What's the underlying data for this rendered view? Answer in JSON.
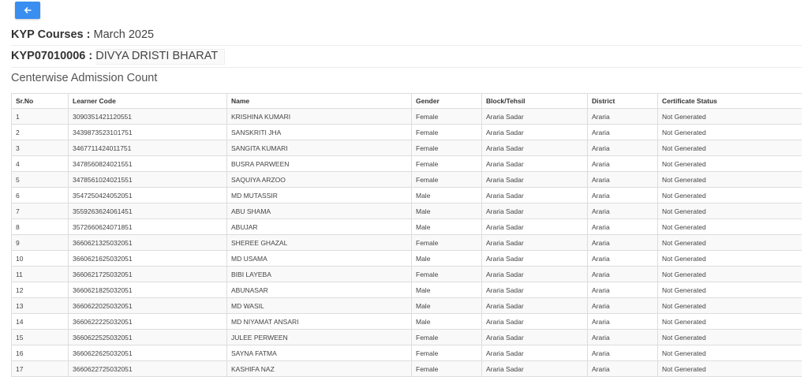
{
  "back_button": {
    "icon": "arrow-left-icon"
  },
  "course": {
    "label": "KYP Courses :",
    "value": "March 2025"
  },
  "center": {
    "code": "KYP07010006 :",
    "name": "DIVYA DRISTI BHARAT"
  },
  "section_title": "Centerwise Admission Count",
  "table": {
    "headers": [
      "Sr.No",
      "Learner Code",
      "Name",
      "Gender",
      "Block/Tehsil",
      "District",
      "Certificate Status"
    ],
    "rows": [
      [
        "1",
        "3090351421120551",
        "KRISHINA KUMARI",
        "Female",
        "Araria Sadar",
        "Araria",
        "Not Generated"
      ],
      [
        "2",
        "3439873523101751",
        "SANSKRITI JHA",
        "Female",
        "Araria Sadar",
        "Araria",
        "Not Generated"
      ],
      [
        "3",
        "3467711424011751",
        "SANGITA KUMARI",
        "Female",
        "Araria Sadar",
        "Araria",
        "Not Generated"
      ],
      [
        "4",
        "3478560824021551",
        "BUSRA PARWEEN",
        "Female",
        "Araria Sadar",
        "Araria",
        "Not Generated"
      ],
      [
        "5",
        "3478561024021551",
        "SAQUIYA ARZOO",
        "Female",
        "Araria Sadar",
        "Araria",
        "Not Generated"
      ],
      [
        "6",
        "3547250424052051",
        "MD MUTASSIR",
        "Male",
        "Araria Sadar",
        "Araria",
        "Not Generated"
      ],
      [
        "7",
        "3559263624061451",
        "ABU SHAMA",
        "Male",
        "Araria Sadar",
        "Araria",
        "Not Generated"
      ],
      [
        "8",
        "3572660624071851",
        "ABUJAR",
        "Male",
        "Araria Sadar",
        "Araria",
        "Not Generated"
      ],
      [
        "9",
        "3660621325032051",
        "SHEREE GHAZAL",
        "Female",
        "Araria Sadar",
        "Araria",
        "Not Generated"
      ],
      [
        "10",
        "3660621625032051",
        "MD USAMA",
        "Male",
        "Araria Sadar",
        "Araria",
        "Not Generated"
      ],
      [
        "11",
        "3660621725032051",
        "BIBI LAYEBA",
        "Female",
        "Araria Sadar",
        "Araria",
        "Not Generated"
      ],
      [
        "12",
        "3660621825032051",
        "ABUNASAR",
        "Male",
        "Araria Sadar",
        "Araria",
        "Not Generated"
      ],
      [
        "13",
        "3660622025032051",
        "MD WASIL",
        "Male",
        "Araria Sadar",
        "Araria",
        "Not Generated"
      ],
      [
        "14",
        "3660622225032051",
        "MD NIYAMAT ANSARI",
        "Male",
        "Araria Sadar",
        "Araria",
        "Not Generated"
      ],
      [
        "15",
        "3660622525032051",
        "JULEE PERWEEN",
        "Female",
        "Araria Sadar",
        "Araria",
        "Not Generated"
      ],
      [
        "16",
        "3660622625032051",
        "SAYNA FATMA",
        "Female",
        "Araria Sadar",
        "Araria",
        "Not Generated"
      ],
      [
        "17",
        "3660622725032051",
        "KASHIFA NAZ",
        "Female",
        "Araria Sadar",
        "Araria",
        "Not Generated"
      ]
    ]
  }
}
